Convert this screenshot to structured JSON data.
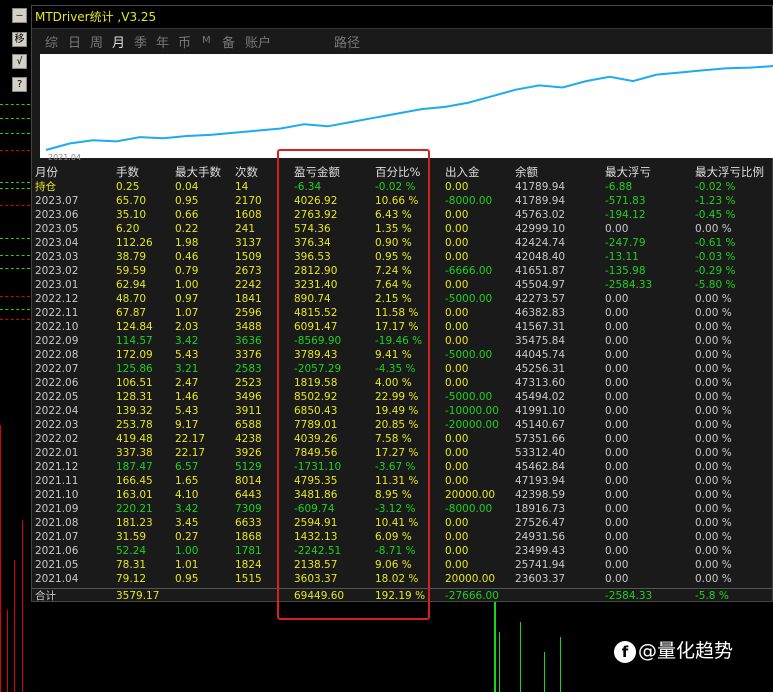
{
  "window": {
    "title": "MTDriver统计 ,V3.25"
  },
  "tabs": [
    "综",
    "日",
    "周",
    "月",
    "季",
    "年",
    "币",
    "M",
    "备",
    "账户",
    "路径"
  ],
  "active_tab": "月",
  "side_buttons": [
    "—",
    "移",
    "√",
    "?"
  ],
  "equity_chart": {
    "start_label": "2021.04",
    "line_color": "#1eaaf0",
    "points": [
      0,
      6,
      9,
      8,
      12,
      11,
      13,
      14,
      16,
      18,
      20,
      24,
      22,
      26,
      30,
      34,
      38,
      40,
      44,
      50,
      56,
      60,
      58,
      64,
      68,
      64,
      70,
      72,
      74,
      76,
      76.5,
      78
    ]
  },
  "table": {
    "headers": [
      "月份",
      "手数",
      "最大手数",
      "次数",
      "盈亏金额",
      "百分比%",
      "出入金",
      "余额",
      "最大浮亏",
      "最大浮亏比例"
    ],
    "holding": [
      "持仓",
      "0.25",
      "0.04",
      "14",
      "-6.34",
      "-0.02 %",
      "0.00",
      "41789.94",
      "-6.88",
      "-0.02 %"
    ],
    "rows": [
      [
        "2023.07",
        "65.70",
        "0.95",
        "2170",
        "4026.92",
        "10.66 %",
        "-8000.00",
        "41789.94",
        "-571.83",
        "-1.23 %"
      ],
      [
        "2023.06",
        "35.10",
        "0.66",
        "1608",
        "2763.92",
        "6.43 %",
        "0.00",
        "45763.02",
        "-194.12",
        "-0.45 %"
      ],
      [
        "2023.05",
        "6.20",
        "0.22",
        "241",
        "574.36",
        "1.35 %",
        "0.00",
        "42999.10",
        "0.00",
        "0.00 %"
      ],
      [
        "2023.04",
        "112.26",
        "1.98",
        "3137",
        "376.34",
        "0.90 %",
        "0.00",
        "42424.74",
        "-247.79",
        "-0.61 %"
      ],
      [
        "2023.03",
        "38.79",
        "0.46",
        "1509",
        "396.53",
        "0.95 %",
        "0.00",
        "42048.40",
        "-13.11",
        "-0.03 %"
      ],
      [
        "2023.02",
        "59.59",
        "0.79",
        "2673",
        "2812.90",
        "7.24 %",
        "-6666.00",
        "41651.87",
        "-135.98",
        "-0.29 %"
      ],
      [
        "2023.01",
        "62.94",
        "1.00",
        "2242",
        "3231.40",
        "7.64 %",
        "0.00",
        "45504.97",
        "-2584.33",
        "-5.80 %"
      ],
      [
        "2022.12",
        "48.70",
        "0.97",
        "1841",
        "890.74",
        "2.15 %",
        "-5000.00",
        "42273.57",
        "0.00",
        "0.00 %"
      ],
      [
        "2022.11",
        "67.87",
        "1.07",
        "2596",
        "4815.52",
        "11.58 %",
        "0.00",
        "46382.83",
        "0.00",
        "0.00 %"
      ],
      [
        "2022.10",
        "124.84",
        "2.03",
        "3488",
        "6091.47",
        "17.17 %",
        "0.00",
        "41567.31",
        "0.00",
        "0.00 %"
      ],
      [
        "2022.09",
        "114.57",
        "3.42",
        "3636",
        "-8569.90",
        "-19.46 %",
        "0.00",
        "35475.84",
        "0.00",
        "0.00 %"
      ],
      [
        "2022.08",
        "172.09",
        "5.43",
        "3376",
        "3789.43",
        "9.41 %",
        "-5000.00",
        "44045.74",
        "0.00",
        "0.00 %"
      ],
      [
        "2022.07",
        "125.86",
        "3.21",
        "2583",
        "-2057.29",
        "-4.35 %",
        "0.00",
        "45256.31",
        "0.00",
        "0.00 %"
      ],
      [
        "2022.06",
        "106.51",
        "2.47",
        "2523",
        "1819.58",
        "4.00 %",
        "0.00",
        "47313.60",
        "0.00",
        "0.00 %"
      ],
      [
        "2022.05",
        "128.31",
        "1.46",
        "3496",
        "8502.92",
        "22.99 %",
        "-5000.00",
        "45494.02",
        "0.00",
        "0.00 %"
      ],
      [
        "2022.04",
        "139.32",
        "5.43",
        "3911",
        "6850.43",
        "19.49 %",
        "-10000.00",
        "41991.10",
        "0.00",
        "0.00 %"
      ],
      [
        "2022.03",
        "253.78",
        "9.17",
        "6588",
        "7789.01",
        "20.85 %",
        "-20000.00",
        "45140.67",
        "0.00",
        "0.00 %"
      ],
      [
        "2022.02",
        "419.48",
        "22.17",
        "4238",
        "4039.26",
        "7.58 %",
        "0.00",
        "57351.66",
        "0.00",
        "0.00 %"
      ],
      [
        "2022.01",
        "337.38",
        "22.17",
        "3926",
        "7849.56",
        "17.27 %",
        "0.00",
        "53312.40",
        "0.00",
        "0.00 %"
      ],
      [
        "2021.12",
        "187.47",
        "6.57",
        "5129",
        "-1731.10",
        "-3.67 %",
        "0.00",
        "45462.84",
        "0.00",
        "0.00 %"
      ],
      [
        "2021.11",
        "166.45",
        "1.65",
        "8014",
        "4795.35",
        "11.31 %",
        "0.00",
        "47193.94",
        "0.00",
        "0.00 %"
      ],
      [
        "2021.10",
        "163.01",
        "4.10",
        "6443",
        "3481.86",
        "8.95 %",
        "20000.00",
        "42398.59",
        "0.00",
        "0.00 %"
      ],
      [
        "2021.09",
        "220.21",
        "3.42",
        "7309",
        "-609.74",
        "-3.12 %",
        "-8000.00",
        "18916.73",
        "0.00",
        "0.00 %"
      ],
      [
        "2021.08",
        "181.23",
        "3.45",
        "6633",
        "2594.91",
        "10.41 %",
        "0.00",
        "27526.47",
        "0.00",
        "0.00 %"
      ],
      [
        "2021.07",
        "31.59",
        "0.27",
        "1868",
        "1432.13",
        "6.09 %",
        "0.00",
        "24931.56",
        "0.00",
        "0.00 %"
      ],
      [
        "2021.06",
        "52.24",
        "1.00",
        "1781",
        "-2242.51",
        "-8.71 %",
        "0.00",
        "23499.43",
        "0.00",
        "0.00 %"
      ],
      [
        "2021.05",
        "78.31",
        "1.01",
        "1824",
        "2138.57",
        "9.06 %",
        "0.00",
        "25741.94",
        "0.00",
        "0.00 %"
      ],
      [
        "2021.04",
        "79.12",
        "0.95",
        "1515",
        "3603.37",
        "18.02 %",
        "20000.00",
        "23603.37",
        "0.00",
        "0.00 %"
      ]
    ],
    "total": [
      "合计",
      "3579.17",
      "",
      "",
      "69449.60",
      "192.19 %",
      "-27666.00",
      "",
      "-2584.33",
      "-5.8 %"
    ]
  },
  "watermark": {
    "logo": "f",
    "text": "@量化趋势"
  },
  "colors": {
    "yellow": "#e6e61e",
    "green": "#1fd11f",
    "white": "#c8c8c8",
    "red_box": "#d42020"
  }
}
